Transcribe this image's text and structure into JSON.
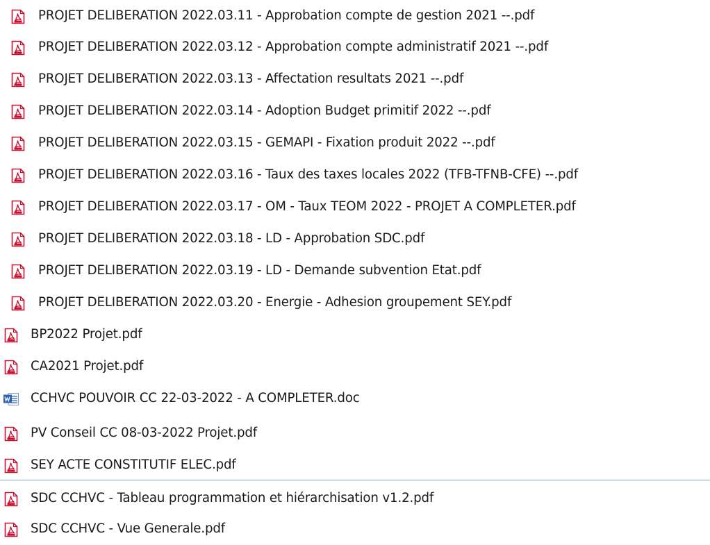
{
  "accent_color": "#7ea6d8",
  "files": [
    {
      "name": "PROJET DELIBERATION 2022.03.11 - Approbation compte de gestion 2021 --.pdf",
      "icon": "pdf-icon",
      "type": "pdf"
    },
    {
      "name": "PROJET DELIBERATION 2022.03.12 - Approbation compte administratif 2021 --.pdf",
      "icon": "pdf-icon",
      "type": "pdf"
    },
    {
      "name": "PROJET DELIBERATION 2022.03.13 - Affectation resultats 2021 --.pdf",
      "icon": "pdf-icon",
      "type": "pdf"
    },
    {
      "name": "PROJET DELIBERATION 2022.03.14 - Adoption Budget primitif 2022 --.pdf",
      "icon": "pdf-icon",
      "type": "pdf"
    },
    {
      "name": "PROJET DELIBERATION 2022.03.15 - GEMAPI - Fixation produit 2022 --.pdf",
      "icon": "pdf-icon",
      "type": "pdf"
    },
    {
      "name": "PROJET DELIBERATION 2022.03.16 - Taux des taxes locales 2022 (TFB-TFNB-CFE) --.pdf",
      "icon": "pdf-icon",
      "type": "pdf"
    },
    {
      "name": "PROJET DELIBERATION 2022.03.17 - OM - Taux TEOM 2022 - PROJET A COMPLETER.pdf",
      "icon": "pdf-icon",
      "type": "pdf"
    },
    {
      "name": "PROJET DELIBERATION 2022.03.18 - LD - Approbation SDC.pdf",
      "icon": "pdf-icon",
      "type": "pdf"
    },
    {
      "name": "PROJET DELIBERATION 2022.03.19 - LD - Demande subvention Etat.pdf",
      "icon": "pdf-icon",
      "type": "pdf"
    },
    {
      "name": "PROJET DELIBERATION 2022.03.20 - Energie - Adhesion groupement SEY.pdf",
      "icon": "pdf-icon",
      "type": "pdf"
    },
    {
      "name": "BP2022 Projet.pdf",
      "icon": "pdf-icon",
      "type": "pdf"
    },
    {
      "name": "CA2021 Projet.pdf",
      "icon": "pdf-icon",
      "type": "pdf"
    },
    {
      "name": "CCHVC POUVOIR CC 22-03-2022 - A COMPLETER.doc",
      "icon": "word-doc-icon",
      "type": "doc"
    },
    {
      "name": "PV Conseil CC 08-03-2022 Projet.pdf",
      "icon": "pdf-icon",
      "type": "pdf"
    },
    {
      "name": "SEY ACTE CONSTITUTIF ELEC.pdf",
      "icon": "pdf-icon",
      "type": "pdf"
    },
    {
      "name": "SDC CCHVC - Tableau programmation et hiérarchisation v1.2.pdf",
      "icon": "pdf-icon",
      "type": "pdf"
    },
    {
      "name": "SDC CCHVC - Vue Generale.pdf",
      "icon": "pdf-icon",
      "type": "pdf"
    }
  ]
}
